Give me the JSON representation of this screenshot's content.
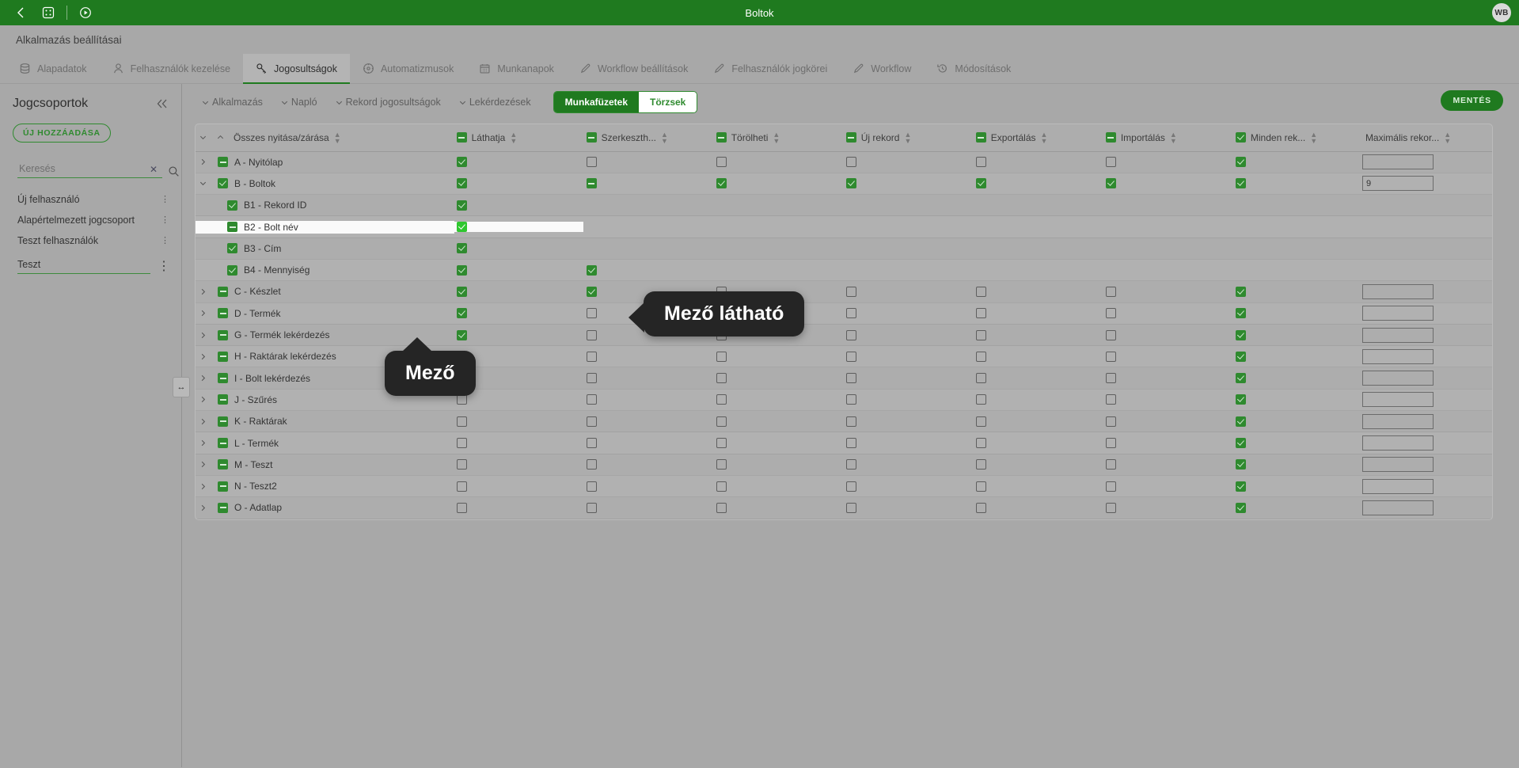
{
  "window": {
    "title": "Boltok",
    "avatar_initials": "WB",
    "nav_icons": [
      "back-icon",
      "grid-icon",
      "play-circle-icon"
    ]
  },
  "app_header": {
    "title": "Alkalmazás beállításai"
  },
  "tabs": [
    {
      "label": "Alapadatok",
      "icon": "database-icon",
      "active": false
    },
    {
      "label": "Felhasználók kezelése",
      "icon": "user-icon",
      "active": false
    },
    {
      "label": "Jogosultságok",
      "icon": "key-icon",
      "active": true
    },
    {
      "label": "Automatizmusok",
      "icon": "gear-circle-icon",
      "active": false
    },
    {
      "label": "Munkanapok",
      "icon": "calendar-icon",
      "active": false
    },
    {
      "label": "Workflow beállítások",
      "icon": "pencil-icon",
      "active": false
    },
    {
      "label": "Felhasználók jogkörei",
      "icon": "pencil-icon",
      "active": false
    },
    {
      "label": "Workflow",
      "icon": "pencil-icon",
      "active": false
    },
    {
      "label": "Módosítások",
      "icon": "history-icon",
      "active": false
    }
  ],
  "sidebar": {
    "title": "Jogcsoportok",
    "collapse_icon": "chevron-double-left-icon",
    "add_button": "ÚJ HOZZÁADÁSA",
    "search": {
      "placeholder": "Keresés",
      "value": "",
      "clear_icon": "close-icon",
      "search_icon": "search-icon"
    },
    "groups": [
      {
        "label": "Új felhasználó",
        "menu_icon": "kebab-menu-icon"
      },
      {
        "label": "Alapértelmezett jogcsoport",
        "menu_icon": "kebab-menu-icon"
      },
      {
        "label": "Teszt felhasználók",
        "menu_icon": "kebab-menu-icon"
      }
    ],
    "edit_row": {
      "value": "Teszt",
      "menu_icon": "kebab-menu-icon"
    },
    "resize_handle_icon": "horizontal-resize-icon"
  },
  "toolbar": {
    "dropdowns": [
      "Alkalmazás",
      "Napló",
      "Rekord jogosultságok",
      "Lekérdezések"
    ],
    "segmented": [
      {
        "label": "Munkafüzetek",
        "selected": true
      },
      {
        "label": "Törzsek",
        "selected": false
      }
    ],
    "save_label": "MENTÉS"
  },
  "table": {
    "columns": [
      {
        "label": "Összes nyitása/zárása",
        "state": null,
        "sortable": true
      },
      {
        "label": "Láthatja",
        "state": "indeterminate",
        "sortable": true
      },
      {
        "label": "Szerkeszth...",
        "state": "indeterminate",
        "sortable": true
      },
      {
        "label": "Törölheti",
        "state": "indeterminate",
        "sortable": true
      },
      {
        "label": "Új rekord",
        "state": "indeterminate",
        "sortable": true
      },
      {
        "label": "Exportálás",
        "state": "indeterminate",
        "sortable": true
      },
      {
        "label": "Importálás",
        "state": "indeterminate",
        "sortable": true
      },
      {
        "label": "Minden rek...",
        "state": "checked",
        "sortable": true
      },
      {
        "label": "Maximális rekor...",
        "state": null,
        "sortable": true
      }
    ],
    "rows": [
      {
        "label": "A - Nyitólap",
        "expander": "collapsed",
        "indent": 0,
        "state": "indeterminate",
        "cells": [
          "checked",
          "empty",
          "empty",
          "empty",
          "empty",
          "empty",
          "checked"
        ],
        "max": "",
        "has_max": true
      },
      {
        "label": "B - Boltok",
        "expander": "expanded",
        "indent": 0,
        "state": "checked",
        "cells": [
          "checked",
          "indeterminate",
          "checked",
          "checked",
          "checked",
          "checked",
          "checked"
        ],
        "max": "9",
        "has_max": true
      },
      {
        "label": "B1 - Rekord ID",
        "expander": "none",
        "indent": 1,
        "state": "checked",
        "cells": [
          "checked",
          "",
          "",
          "",
          "",
          "",
          ""
        ],
        "max": "",
        "has_max": false
      },
      {
        "label": "B2 - Bolt név",
        "expander": "none",
        "indent": 1,
        "state": "indeterminate",
        "highlight": true,
        "cells": [
          "bright",
          "",
          "",
          "",
          "",
          "",
          ""
        ],
        "max": "",
        "has_max": false
      },
      {
        "label": "B3 - Cím",
        "expander": "none",
        "indent": 1,
        "state": "checked",
        "cells": [
          "checked",
          "",
          "",
          "",
          "",
          "",
          ""
        ],
        "max": "",
        "has_max": false
      },
      {
        "label": "B4 - Mennyiség",
        "expander": "none",
        "indent": 1,
        "state": "checked",
        "cells": [
          "checked",
          "checked",
          "",
          "",
          "",
          "",
          ""
        ],
        "max": "",
        "has_max": false
      },
      {
        "label": "C - Készlet",
        "expander": "collapsed",
        "indent": 0,
        "state": "indeterminate",
        "cells": [
          "checked",
          "checked",
          "empty",
          "empty",
          "empty",
          "empty",
          "checked"
        ],
        "max": "",
        "has_max": true
      },
      {
        "label": "D - Termék",
        "expander": "collapsed",
        "indent": 0,
        "state": "indeterminate",
        "cells": [
          "checked",
          "empty",
          "empty",
          "empty",
          "empty",
          "empty",
          "checked"
        ],
        "max": "",
        "has_max": true
      },
      {
        "label": "G - Termék lekérdezés",
        "expander": "collapsed",
        "indent": 0,
        "state": "indeterminate",
        "cells": [
          "checked",
          "empty",
          "empty",
          "empty",
          "empty",
          "empty",
          "checked"
        ],
        "max": "",
        "has_max": true
      },
      {
        "label": "H - Raktárak lekérdezés",
        "expander": "collapsed",
        "indent": 0,
        "state": "indeterminate",
        "cells": [
          "empty",
          "empty",
          "empty",
          "empty",
          "empty",
          "empty",
          "checked"
        ],
        "max": "",
        "has_max": true
      },
      {
        "label": "I - Bolt lekérdezés",
        "expander": "collapsed",
        "indent": 0,
        "state": "indeterminate",
        "cells": [
          "checked",
          "empty",
          "empty",
          "empty",
          "empty",
          "empty",
          "checked"
        ],
        "max": "",
        "has_max": true
      },
      {
        "label": "J - Szűrés",
        "expander": "collapsed",
        "indent": 0,
        "state": "indeterminate",
        "cells": [
          "empty",
          "empty",
          "empty",
          "empty",
          "empty",
          "empty",
          "checked"
        ],
        "max": "",
        "has_max": true
      },
      {
        "label": "K - Raktárak",
        "expander": "collapsed",
        "indent": 0,
        "state": "indeterminate",
        "cells": [
          "empty",
          "empty",
          "empty",
          "empty",
          "empty",
          "empty",
          "checked"
        ],
        "max": "",
        "has_max": true
      },
      {
        "label": "L - Termék",
        "expander": "collapsed",
        "indent": 0,
        "state": "indeterminate",
        "cells": [
          "empty",
          "empty",
          "empty",
          "empty",
          "empty",
          "empty",
          "checked"
        ],
        "max": "",
        "has_max": true
      },
      {
        "label": "M - Teszt",
        "expander": "collapsed",
        "indent": 0,
        "state": "indeterminate",
        "cells": [
          "empty",
          "empty",
          "empty",
          "empty",
          "empty",
          "empty",
          "checked"
        ],
        "max": "",
        "has_max": true
      },
      {
        "label": "N - Teszt2",
        "expander": "collapsed",
        "indent": 0,
        "state": "indeterminate",
        "cells": [
          "empty",
          "empty",
          "empty",
          "empty",
          "empty",
          "empty",
          "checked"
        ],
        "max": "",
        "has_max": true
      },
      {
        "label": "O - Adatlap",
        "expander": "collapsed",
        "indent": 0,
        "state": "indeterminate",
        "cells": [
          "empty",
          "empty",
          "empty",
          "empty",
          "empty",
          "empty",
          "checked"
        ],
        "max": "",
        "has_max": true
      }
    ]
  },
  "tooltips": [
    {
      "id": "field",
      "text": "Mező"
    },
    {
      "id": "visible",
      "text": "Mező látható"
    }
  ],
  "colors": {
    "brand_green": "#1f7a1f",
    "accent_green": "#2f8a2f",
    "bright_green": "#2fc72f",
    "page_bg": "#a8a8a8",
    "tooltip_bg": "#252525"
  }
}
